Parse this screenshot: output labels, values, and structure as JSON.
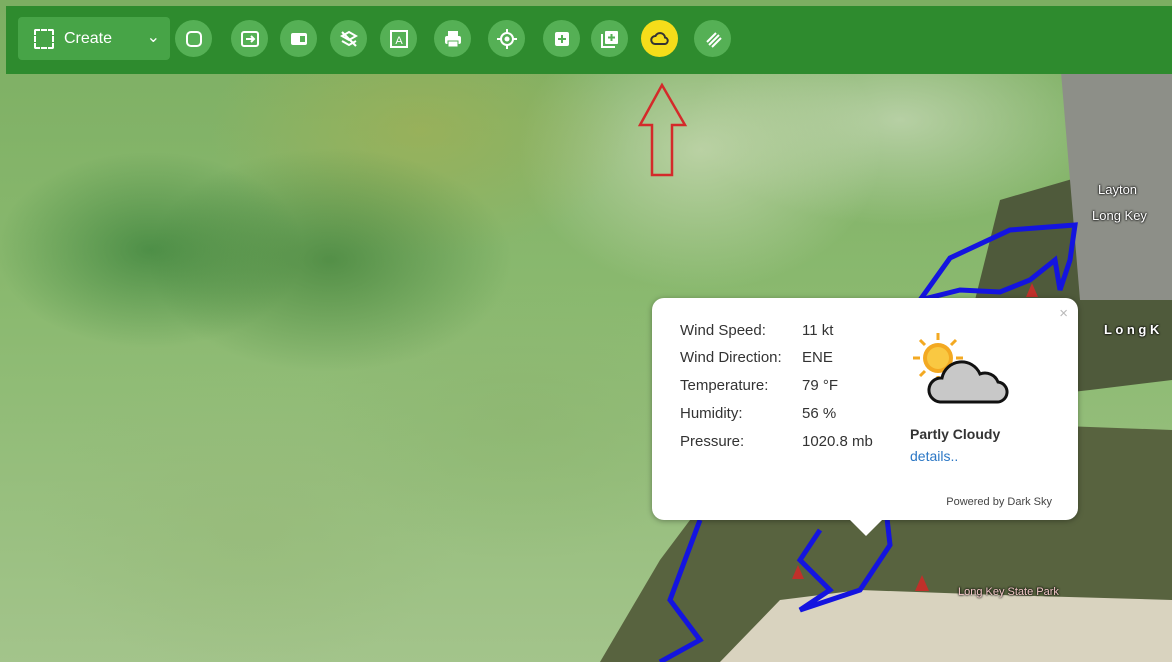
{
  "toolbar": {
    "create_label": "Create",
    "tools": [
      {
        "name": "select-tool-icon"
      },
      {
        "name": "import-icon"
      },
      {
        "name": "panel-icon"
      },
      {
        "name": "layers-off-icon"
      },
      {
        "name": "text-frame-icon"
      },
      {
        "name": "print-icon"
      },
      {
        "name": "locate-icon"
      },
      {
        "name": "add-box-icon"
      },
      {
        "name": "add-layer-icon"
      },
      {
        "name": "weather-cloud-icon",
        "active": true
      },
      {
        "name": "hatch-icon"
      }
    ],
    "colors": {
      "bar": "#2e8b2e",
      "button": "#55b055",
      "active": "#f5dd1a",
      "arrow": "#d42a2a"
    }
  },
  "weather": {
    "rows": [
      {
        "label": "Wind Speed:",
        "value": "11 kt"
      },
      {
        "label": "Wind Direction:",
        "value": "ENE"
      },
      {
        "label": "Temperature:",
        "value": "79 °F"
      },
      {
        "label": "Humidity:",
        "value": "56 %"
      },
      {
        "label": "Pressure:",
        "value": "1020.8 mb"
      }
    ],
    "condition": "Partly Cloudy",
    "details_link": "details..",
    "powered_by": "Powered by Dark Sky",
    "close": "×"
  },
  "map_labels": {
    "layton": "Layton",
    "long_key": "Long Key",
    "long_k": "L o n g  K",
    "state_park": "Long Key State Park"
  }
}
